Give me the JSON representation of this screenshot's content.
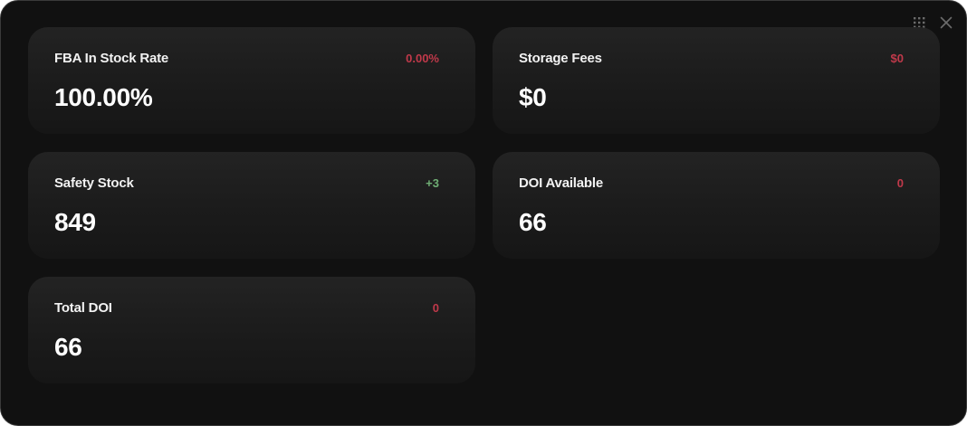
{
  "controls": {
    "grid_icon": "grid-dots-icon",
    "close_icon": "close-icon"
  },
  "colors": {
    "panel_bg": "#111111",
    "card_bg": "#1e1e1e",
    "negative": "#c0394a",
    "positive": "#6fae74"
  },
  "cards": [
    {
      "title": "FBA In Stock Rate",
      "value": "100.00%",
      "delta": "0.00%",
      "trend": "negative"
    },
    {
      "title": "Storage Fees",
      "value": "$0",
      "delta": "$0",
      "trend": "negative"
    },
    {
      "title": "Safety Stock",
      "value": "849",
      "delta": "+3",
      "trend": "positive"
    },
    {
      "title": "DOI Available",
      "value": "66",
      "delta": "0",
      "trend": "negative"
    },
    {
      "title": "Total DOI",
      "value": "66",
      "delta": "0",
      "trend": "negative"
    }
  ]
}
